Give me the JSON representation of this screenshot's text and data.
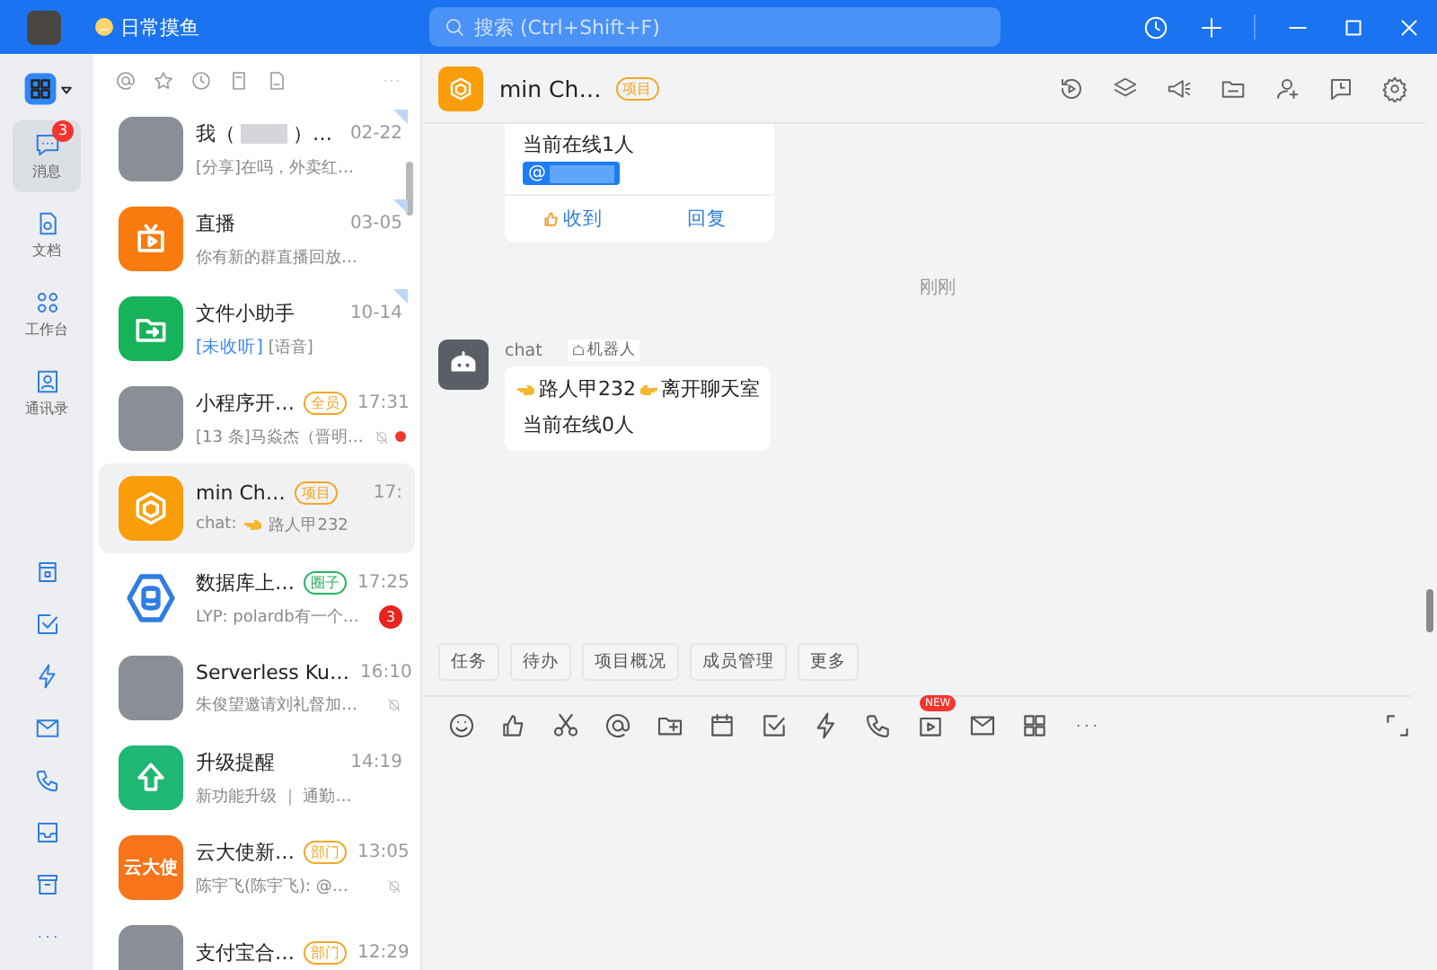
{
  "title_bar": {
    "group_name": "日常摸鱼",
    "search": {
      "placeholder": "搜索 (Ctrl+Shift+F)"
    }
  },
  "nav": {
    "items": [
      {
        "label": "消息",
        "selected": true,
        "badge": "3"
      },
      {
        "label": "文档",
        "selected": false
      },
      {
        "label": "工作台",
        "selected": false
      },
      {
        "label": "通讯录",
        "selected": false
      }
    ]
  },
  "conversations": [
    {
      "name": "我（",
      "redacted": true,
      "name_end": "）…",
      "time": "02-22",
      "preview": "[分享]在吗，外卖红…",
      "pinned": true,
      "selected": false,
      "muted": false,
      "avatar": {
        "kind": "photo"
      }
    },
    {
      "name": "直播",
      "time": "03-05",
      "preview": "你有新的群直播回放…",
      "pinned": true,
      "selected": false,
      "muted": false,
      "avatar": {
        "kind": "icon",
        "color": "#f77b0f"
      }
    },
    {
      "name": "文件小助手",
      "time": "10-14",
      "preview_highlight": "[未收听]",
      "preview": "[语音]",
      "pinned": true,
      "selected": false,
      "muted": false,
      "avatar": {
        "kind": "icon",
        "color": "#17b35a"
      }
    },
    {
      "name": "小程序开…",
      "tag": {
        "text": "全员",
        "color": "#f5a623"
      },
      "time": "17:31",
      "preview": "[13 条]马焱杰（晋明…",
      "pinned": false,
      "selected": false,
      "muted": true,
      "unread_dot": true,
      "avatar": {
        "kind": "photo"
      }
    },
    {
      "name": "min Ch…",
      "tag": {
        "text": "项目",
        "color": "#f5a623"
      },
      "time": "17:",
      "preview": "chat:",
      "preview_actor": "路人甲232",
      "pinned": false,
      "selected": true,
      "muted": false,
      "avatar": {
        "kind": "icon",
        "color": "#f99d0a"
      }
    },
    {
      "name": "数据库上…",
      "tag": {
        "text": "圈子",
        "color": "#27b35f"
      },
      "time": "17:25",
      "preview": "LYP: polardb有一个…",
      "badge": "3",
      "pinned": false,
      "selected": false,
      "muted": false,
      "avatar": {
        "kind": "outline",
        "color": "#2f7de1"
      }
    },
    {
      "name": "Serverless Ku…",
      "time": "16:10",
      "preview": "朱俊望邀请刘礼督加…",
      "pinned": false,
      "selected": false,
      "muted": true,
      "avatar": {
        "kind": "photo"
      }
    },
    {
      "name": "升级提醒",
      "time": "14:19",
      "preview": "新功能升级 ｜ 通勤…",
      "pinned": false,
      "selected": false,
      "muted": false,
      "avatar": {
        "kind": "icon",
        "color": "#1fb774"
      }
    },
    {
      "name": "云大使新…",
      "tag": {
        "text": "部门",
        "color": "#f5a623"
      },
      "time": "13:05",
      "preview": "陈宇飞(陈宇飞): @…",
      "pinned": false,
      "selected": false,
      "muted": true,
      "avatar": {
        "kind": "text",
        "text": "云大使",
        "color": "#f7741a"
      }
    },
    {
      "name": "支付宝合…",
      "tag": {
        "text": "部门",
        "color": "#f5a623"
      },
      "time": "12:29",
      "pinned": false,
      "selected": false,
      "muted": false,
      "avatar": {
        "kind": "photo"
      }
    }
  ],
  "chat": {
    "title": "min Ch…",
    "tag": "项目",
    "card": {
      "text": "当前在线1人",
      "mention": "@",
      "actions": [
        "收到",
        "回复"
      ]
    },
    "time_divider": "刚刚",
    "bot_message": {
      "sender": "chat",
      "sender_tag": "机器人",
      "actor": "路人甲232",
      "event": "离开聊天室",
      "status": "当前在线0人"
    },
    "quick_actions": [
      "任务",
      "待办",
      "项目概况",
      "成员管理",
      "更多"
    ],
    "toolbar_badge": "NEW"
  }
}
